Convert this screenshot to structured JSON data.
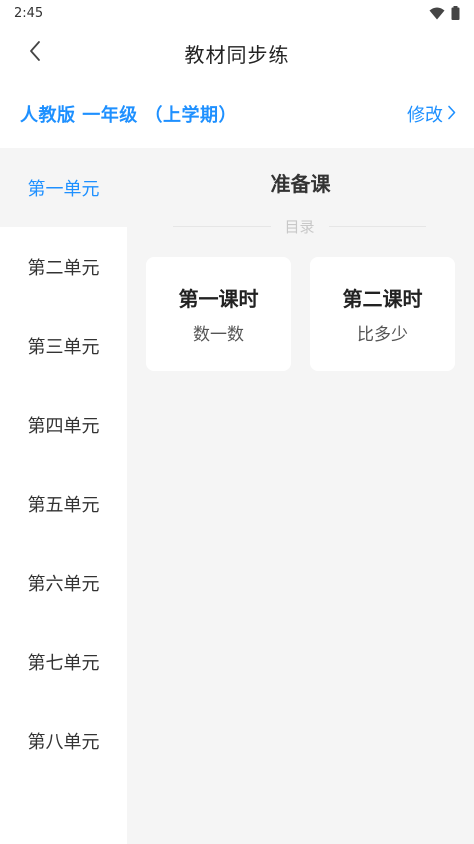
{
  "status_bar": {
    "time": "2:45",
    "icons": [
      "wifi-icon",
      "battery-icon"
    ]
  },
  "header": {
    "title": "教材同步练",
    "back_icon": "chevron-left-icon"
  },
  "edition": {
    "label": "人教版 一年级 （上学期）",
    "edit_label": "修改",
    "edit_icon": "chevron-right-icon"
  },
  "sidebar": {
    "items": [
      {
        "label": "第一单元",
        "active": true
      },
      {
        "label": "第二单元",
        "active": false
      },
      {
        "label": "第三单元",
        "active": false
      },
      {
        "label": "第四单元",
        "active": false
      },
      {
        "label": "第五单元",
        "active": false
      },
      {
        "label": "第六单元",
        "active": false
      },
      {
        "label": "第七单元",
        "active": false
      },
      {
        "label": "第八单元",
        "active": false
      }
    ]
  },
  "content": {
    "section_title": "准备课",
    "toc_label": "目录",
    "lessons": [
      {
        "title": "第一课时",
        "subtitle": "数一数"
      },
      {
        "title": "第二课时",
        "subtitle": "比多少"
      }
    ]
  },
  "colors": {
    "accent": "#1e90ff",
    "panel_bg": "#f5f5f5",
    "card_bg": "#ffffff"
  }
}
